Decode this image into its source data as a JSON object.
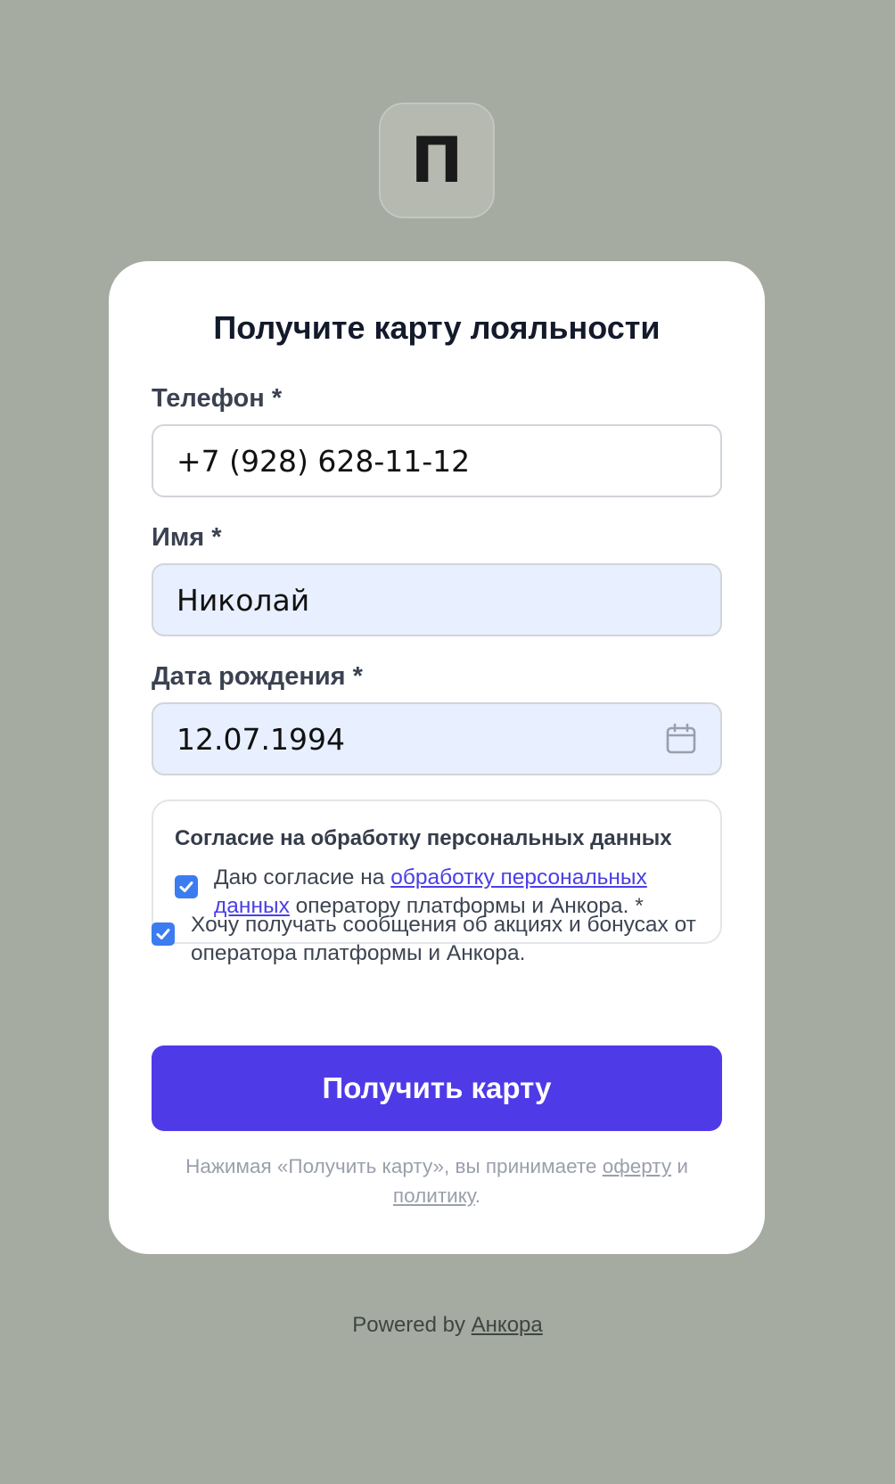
{
  "logo": {
    "letter": "П"
  },
  "form": {
    "title": "Получите карту лояльности",
    "phone": {
      "label": "Телефон *",
      "value": "+7 (928) 628-11-12"
    },
    "name": {
      "label": "Имя *",
      "value": "Николай"
    },
    "birthdate": {
      "label": "Дата рождения *",
      "value": "12.07.1994",
      "icon": "calendar-icon"
    },
    "consent": {
      "title": "Согласие на обработку персональных данных",
      "checked": true,
      "text_prefix": "Даю согласие на ",
      "link_text": "обработку персональных данных",
      "text_suffix": " оператору платформы и Анкора. *"
    },
    "marketing": {
      "checked": true,
      "text": "Хочу получать сообщения об акциях и бонусах от оператора платформы и Анкора."
    },
    "submit_label": "Получить карту",
    "terms": {
      "prefix": "Нажимая «Получить карту», вы принимаете ",
      "offer_link": "оферту",
      "middle": " и ",
      "policy_link": "политику",
      "suffix": "."
    }
  },
  "footer": {
    "powered_prefix": "Powered by ",
    "brand_link": "Анкора"
  },
  "colors": {
    "background": "#a5aba0",
    "accent": "#4f3ae8",
    "checkbox": "#3b7cf0",
    "filled_input": "#e8effe"
  }
}
